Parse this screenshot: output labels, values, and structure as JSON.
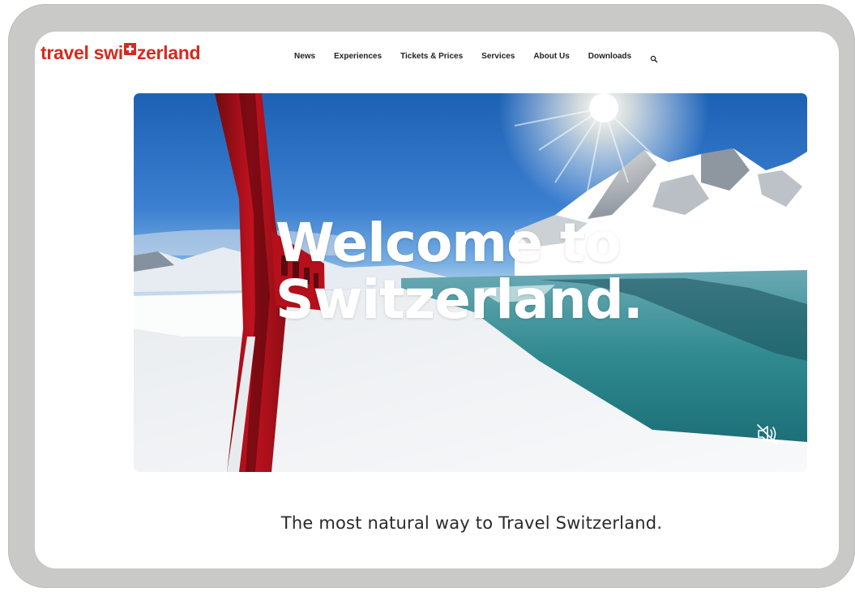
{
  "header": {
    "logo_left": "travel swi",
    "logo_right": "zerland",
    "nav": [
      "News",
      "Experiences",
      "Tickets & Prices",
      "Services",
      "About Us",
      "Downloads"
    ],
    "search_icon": "search-icon"
  },
  "hero": {
    "headline_line1": "Welcome to",
    "headline_line2": "Switzerland.",
    "mute_icon": "speaker-muted-icon"
  },
  "tagline": "The most natural way to Travel Switzerland.",
  "colors": {
    "brand_red": "#d52b1e",
    "bezel": "#c9c9c7"
  }
}
